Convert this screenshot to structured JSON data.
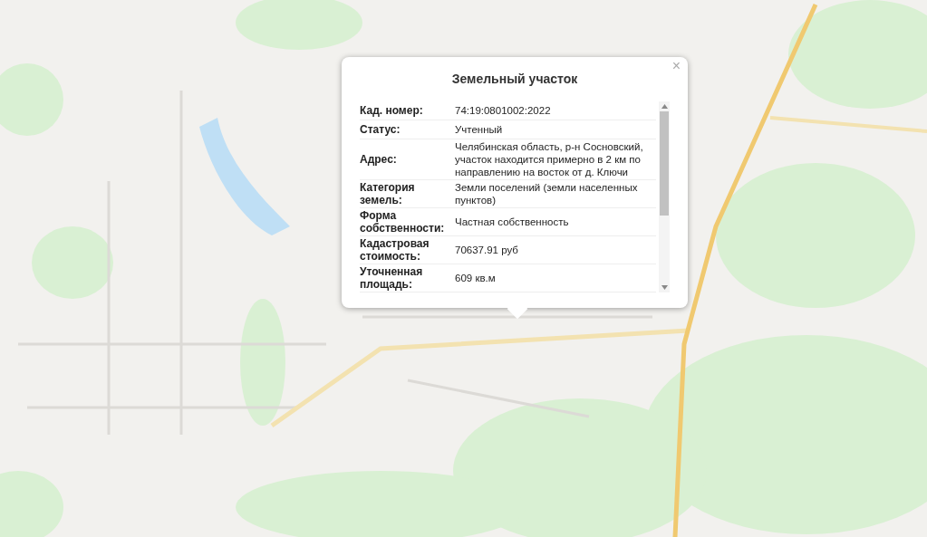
{
  "popup": {
    "title": "Земельный участок",
    "close": "×",
    "rows": [
      {
        "label": "Кад. номер:",
        "value": "74:19:0801002:2022"
      },
      {
        "label": "Статус:",
        "value": "Учтенный"
      },
      {
        "label": "Адрес:",
        "value": "Челябинская область, р-н Сосновский, участок находится примерно в 2 км по направлению на восток от д. Ключи"
      },
      {
        "label": "Категория земель:",
        "value": "Земли поселений (земли населенных пунктов)"
      },
      {
        "label": "Форма собственности:",
        "value": "Частная собственность"
      },
      {
        "label": "Кадастровая стоимость:",
        "value": "70637.91 руб"
      },
      {
        "label": "Уточненная площадь:",
        "value": "609 кв.м"
      }
    ]
  }
}
